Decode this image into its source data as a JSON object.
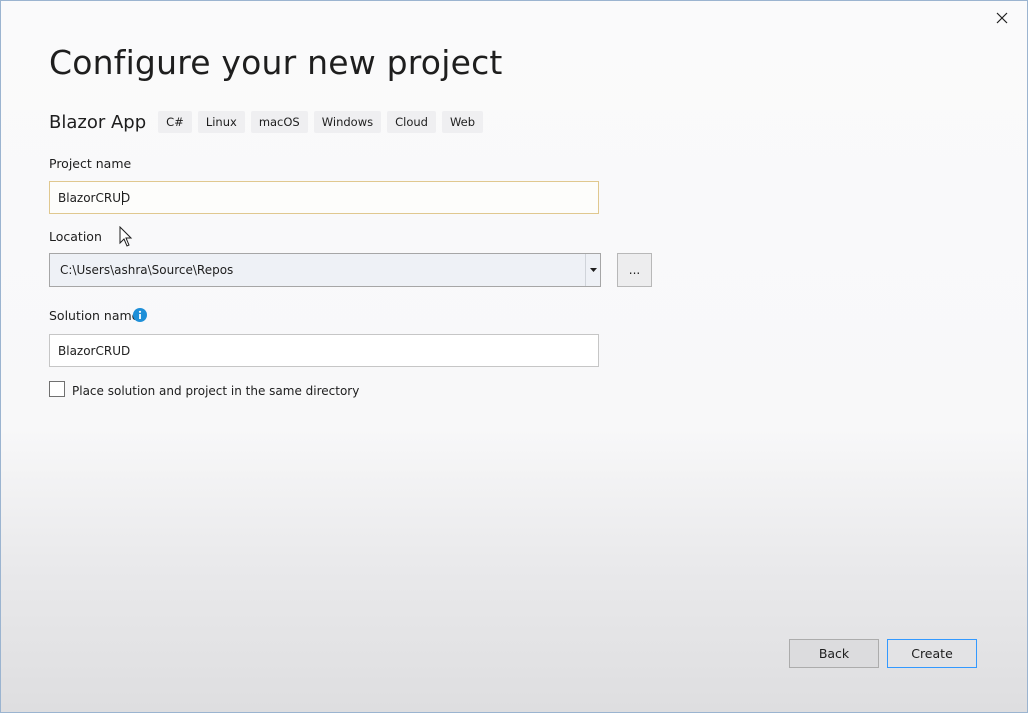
{
  "dialog": {
    "title": "Configure your new project",
    "close_icon": "close-icon"
  },
  "template": {
    "name": "Blazor App",
    "tags": [
      "C#",
      "Linux",
      "macOS",
      "Windows",
      "Cloud",
      "Web"
    ]
  },
  "project_name": {
    "label": "Project name",
    "value": "BlazorCRUD"
  },
  "location": {
    "label": "Location",
    "value": "C:\\Users\\ashra\\Source\\Repos",
    "browse_label": "..."
  },
  "solution_name": {
    "label": "Solution name",
    "value": "BlazorCRUD",
    "info_icon": "info-icon"
  },
  "same_directory": {
    "label": "Place solution and project in the same directory",
    "checked": false
  },
  "footer": {
    "back_label": "Back",
    "create_label": "Create"
  },
  "colors": {
    "accent": "#3399ff",
    "focus_border": "#e0c88f",
    "info_icon": "#1e8fd8"
  }
}
